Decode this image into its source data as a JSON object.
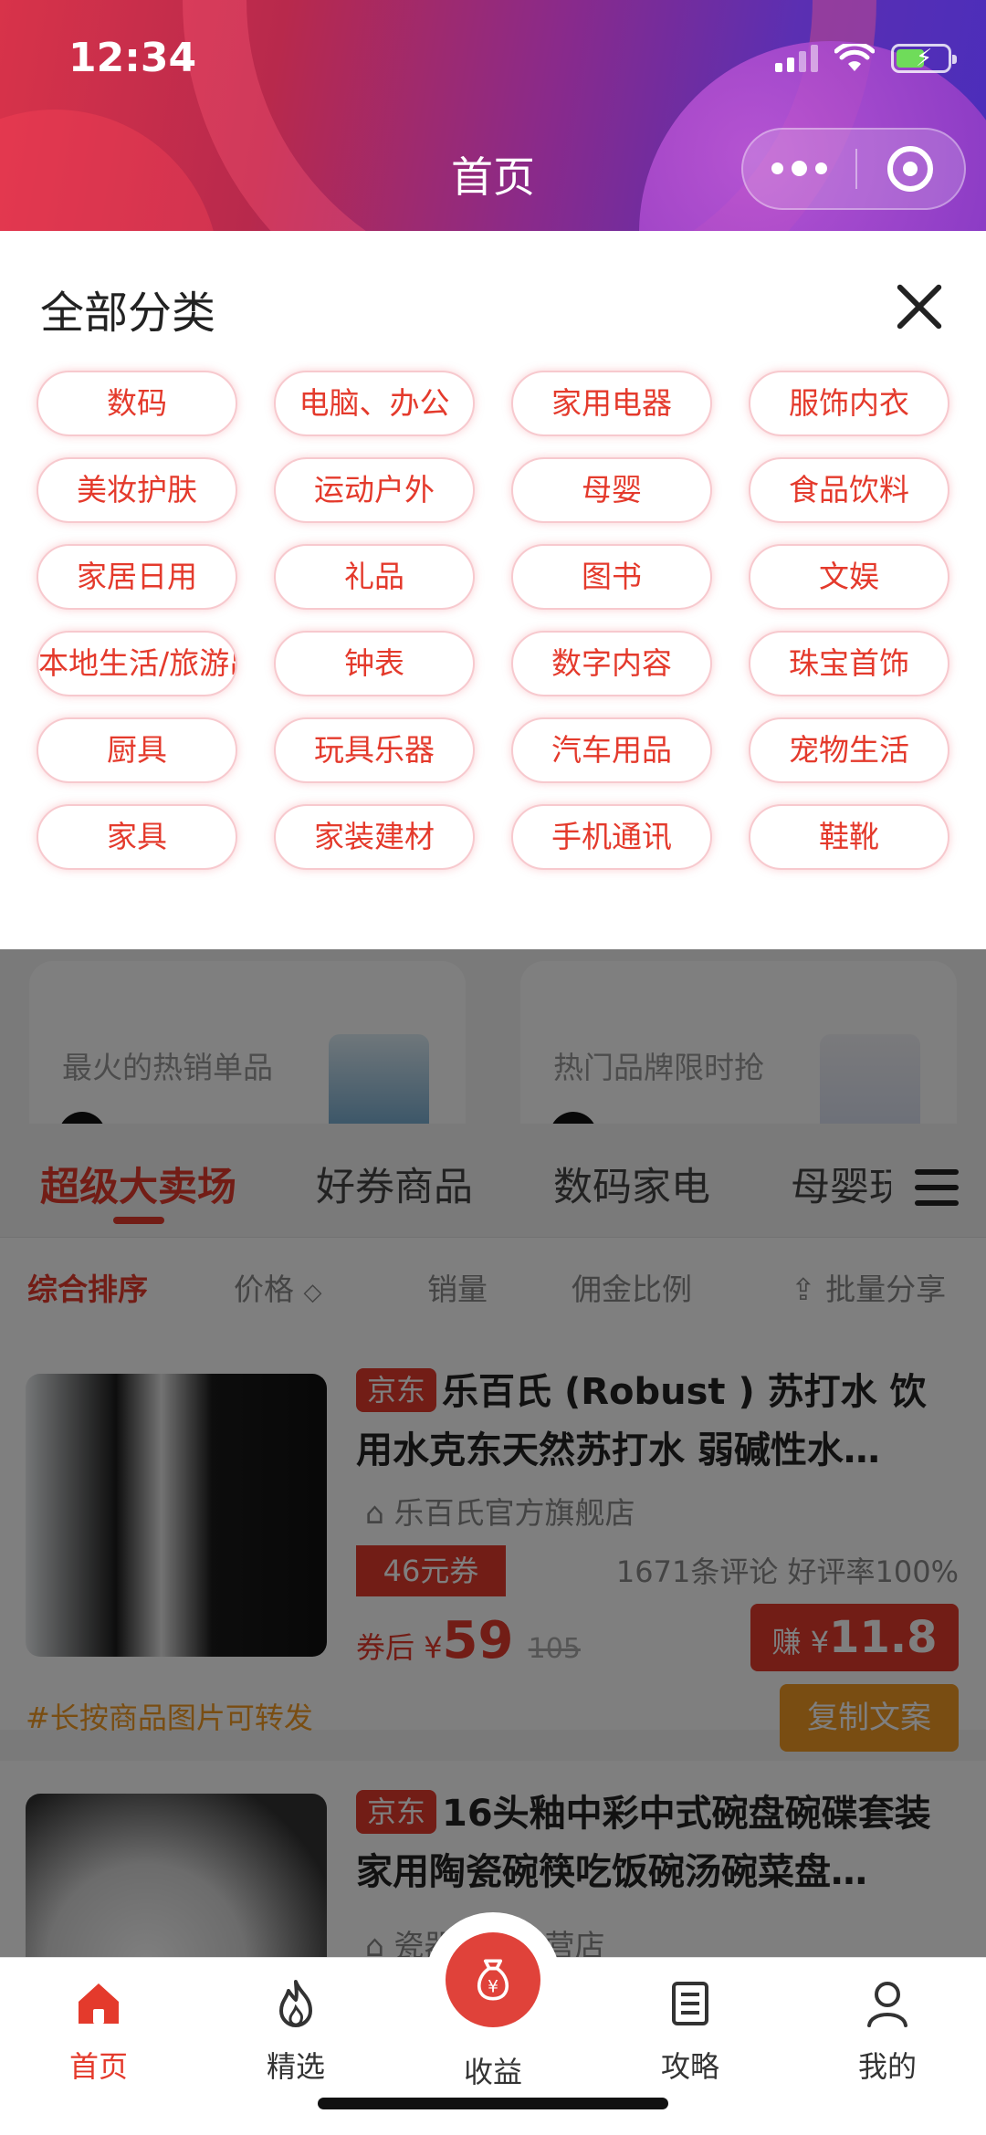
{
  "status": {
    "time": "12:34"
  },
  "nav": {
    "title": "首页"
  },
  "panel": {
    "title": "全部分类",
    "categories": [
      "数码",
      "电脑、办公",
      "家用电器",
      "服饰内衣",
      "美妆护肤",
      "运动户外",
      "母婴",
      "食品饮料",
      "家居日用",
      "礼品",
      "图书",
      "文娱",
      "本地生活/旅游出行",
      "钟表",
      "数字内容",
      "珠宝首饰",
      "厨具",
      "玩具乐器",
      "汽车用品",
      "宠物生活",
      "家具",
      "家装建材",
      "手机通讯",
      "鞋靴"
    ]
  },
  "promos": [
    {
      "subtitle": "最火的热销单品"
    },
    {
      "subtitle": "热门品牌限时抢"
    }
  ],
  "tabs": [
    "超级大卖场",
    "好券商品",
    "数码家电",
    "母婴玩具"
  ],
  "sort": {
    "items": [
      "综合排序",
      "价格",
      "销量",
      "佣金比例"
    ],
    "share": "批量分享"
  },
  "products": [
    {
      "tag": "京东",
      "title": "乐百氏 (Robust ) 苏打水 饮用水克东天然苏打水 弱碱性水…",
      "shop": "乐百氏官方旗舰店",
      "coupon": "46元券",
      "reviews": "1671条评论  好评率100%",
      "price_prefix": "券后",
      "currency": "¥",
      "price": "59",
      "original_price": "105",
      "earn_label": "赚",
      "earn": "11.8",
      "copy_label": "复制文案",
      "hint": "#长按商品图片可转发"
    },
    {
      "tag": "京东",
      "title": "16头釉中彩中式碗盘碗碟套装 家用陶瓷碗筷吃饭碗汤碗菜盘…",
      "shop": "瓷器拼购专营店"
    }
  ],
  "bottom_nav": [
    {
      "label": "首页",
      "icon": "home-icon"
    },
    {
      "label": "精选",
      "icon": "flame-icon"
    },
    {
      "label": "收益",
      "icon": "money-bag-icon"
    },
    {
      "label": "攻略",
      "icon": "notebook-icon"
    },
    {
      "label": "我的",
      "icon": "user-icon"
    }
  ],
  "colors": {
    "accent": "#e43a2c",
    "orange": "#f39a24"
  }
}
